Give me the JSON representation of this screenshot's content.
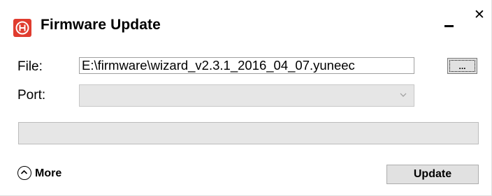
{
  "window": {
    "title": "Firmware Update",
    "minimize_label": "",
    "close_label": "✕"
  },
  "file": {
    "label": "File:",
    "value": "E:\\firmware\\wizard_v2.3.1_2016_04_07.yuneec",
    "browse_label": "..."
  },
  "port": {
    "label": "Port:",
    "selected": ""
  },
  "progress": {
    "value": 0
  },
  "footer": {
    "more_label": "More",
    "update_label": "Update"
  },
  "colors": {
    "logo": "#e03c2f",
    "button_bg": "#e1e1e1",
    "disabled_bg": "#e6e6e6"
  },
  "icons": {
    "logo": "yuneec-h-logo-icon",
    "minimize": "minimize-icon",
    "close": "close-icon",
    "chevron": "chevron-down-icon",
    "more": "chevron-up-circle-icon"
  }
}
